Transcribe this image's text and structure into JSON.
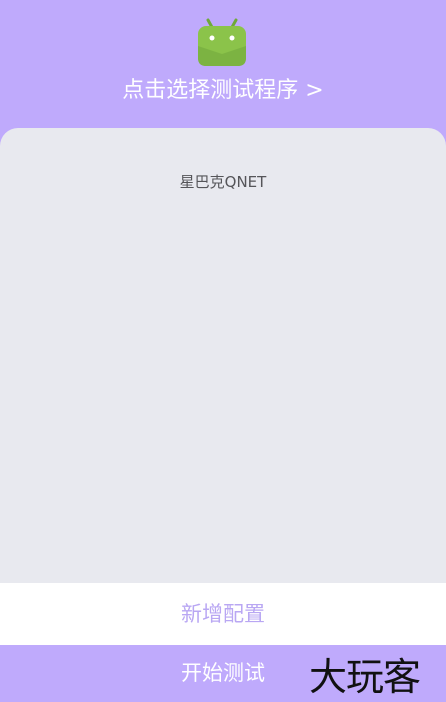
{
  "header": {
    "select_program_label": "点击选择测试程序 >",
    "app_icon": "android-icon"
  },
  "program_list": {
    "items": [
      "星巴克QNET"
    ]
  },
  "actions": {
    "add_config_label": "新增配置",
    "start_test_label": "开始测试"
  },
  "watermark": {
    "text": "大玩客"
  },
  "colors": {
    "accent": "#bfaafc",
    "panel": "#e8e9ef",
    "android_green": "#8bc34a"
  }
}
